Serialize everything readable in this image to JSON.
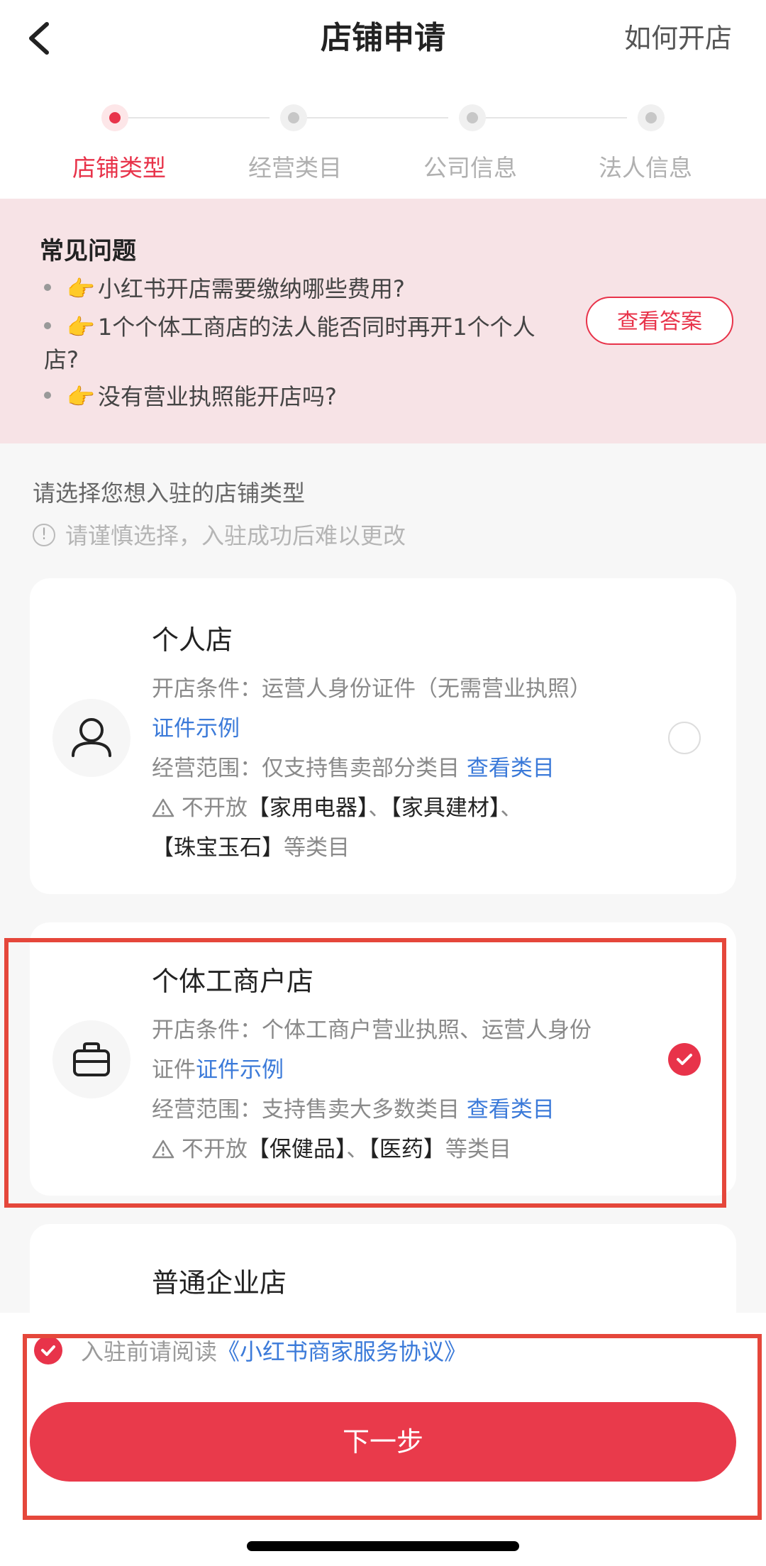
{
  "header": {
    "title": "店铺申请",
    "help_link": "如何开店"
  },
  "stepper": {
    "steps": [
      {
        "label": "店铺类型",
        "active": true
      },
      {
        "label": "经营类目",
        "active": false
      },
      {
        "label": "公司信息",
        "active": false
      },
      {
        "label": "法人信息",
        "active": false
      }
    ]
  },
  "faq": {
    "title": "常见问题",
    "items": [
      "小红书开店需要缴纳哪些费用?",
      "1个个体工商店的法人能否同时再开1个个人店?",
      "没有营业执照能开店吗?"
    ],
    "emoji": "👉",
    "button": "查看答案"
  },
  "section": {
    "title": "请选择您想入驻的店铺类型",
    "note": "请谨慎选择，入驻成功后难以更改"
  },
  "cards": [
    {
      "name": "个人店",
      "icon": "person-icon",
      "condition_label": "开店条件：",
      "condition_text": "运营人身份证件（无需营业执照）",
      "example_link": "证件示例",
      "scope_label": "经营范围：",
      "scope_text": "仅支持售卖部分类目",
      "scope_link": "查看类目",
      "restriction_prefix": "不开放",
      "restriction_1": "【家用电器】",
      "restriction_sep": "、",
      "restriction_2": "【家具建材】",
      "restriction_sep2": "、",
      "restriction_3": "【珠宝玉石】",
      "restriction_suffix": "等类目",
      "selected": false
    },
    {
      "name": "个体工商户店",
      "icon": "briefcase-icon",
      "condition_label": "开店条件：",
      "condition_text": "个体工商户营业执照、运营人身份证件",
      "example_link": "证件示例",
      "scope_label": "经营范围：",
      "scope_text": "支持售卖大多数类目",
      "scope_link": "查看类目",
      "restriction_prefix": "不开放",
      "restriction_1": "【保健品】",
      "restriction_sep": "、",
      "restriction_2": "【医药】",
      "restriction_suffix": "等类目",
      "selected": true
    },
    {
      "name": "普通企业店"
    }
  ],
  "bottom": {
    "agree_prefix": "入驻前请阅读",
    "agree_link": "《小红书商家服务协议》",
    "agreed": true,
    "next_button": "下一步"
  },
  "colors": {
    "accent": "#e8334a",
    "link": "#3b7ad9",
    "faq_bg": "#f7e3e6",
    "annotation": "#e5473b"
  }
}
